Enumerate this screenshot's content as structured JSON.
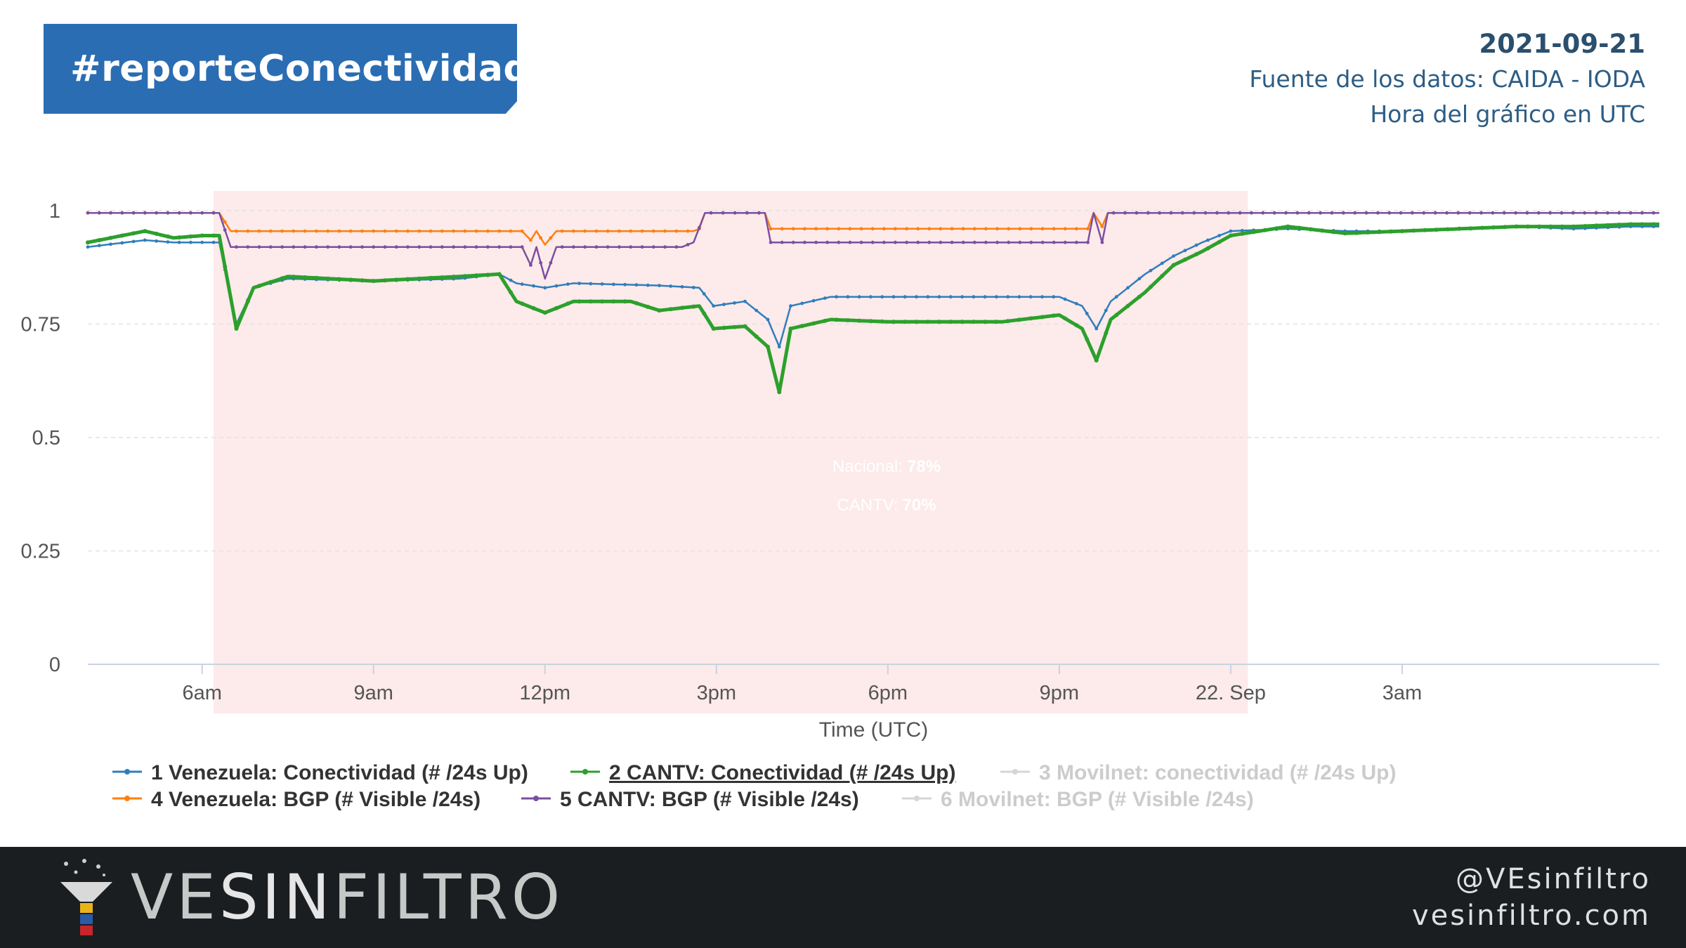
{
  "header": {
    "hashtag": "#reporteConectividad",
    "date": "2021-09-21",
    "source": "Fuente de los datos: CAIDA - IODA",
    "time_note": "Hora del gráfico en UTC"
  },
  "badges": {
    "national_label": "Nacional:",
    "national_value": "78%",
    "cantv_label": "CANTV:",
    "cantv_value": "70%"
  },
  "footer": {
    "brand_a": "VE",
    "brand_b": "SIN",
    "brand_c": "FILTRO",
    "handle": "@VEsinfiltro",
    "site": "vesinfiltro.com"
  },
  "colors": {
    "nacional": "#2f7ebc",
    "cantv": "#2ca02c",
    "bgp_ve": "#ff7f0e",
    "bgp_cantv": "#7b4fa0",
    "disabled": "#d6d6d6",
    "shade": "#fdeaea",
    "badge_blue": "#2a6db3",
    "badge_green": "#2ca02c"
  },
  "chart_data": {
    "type": "line",
    "xlabel": "Time (UTC)",
    "ylabel": "",
    "ylim": [
      0,
      1
    ],
    "xlim_hours": [
      4,
      31.5
    ],
    "x_unit": "hours since 2021-09-21 00:00 UTC",
    "yticks": [
      {
        "value": 0,
        "label": "0"
      },
      {
        "value": 0.25,
        "label": "0.25"
      },
      {
        "value": 0.5,
        "label": "0.5"
      },
      {
        "value": 0.75,
        "label": "0.75"
      },
      {
        "value": 1,
        "label": "1"
      }
    ],
    "xticks": [
      {
        "value": 6,
        "label": "6am"
      },
      {
        "value": 9,
        "label": "9am"
      },
      {
        "value": 12,
        "label": "12pm"
      },
      {
        "value": 15,
        "label": "3pm"
      },
      {
        "value": 18,
        "label": "6pm"
      },
      {
        "value": 21,
        "label": "9pm"
      },
      {
        "value": 24,
        "label": "22. Sep"
      },
      {
        "value": 27,
        "label": "3am"
      }
    ],
    "highlight_band": [
      6.2,
      24.3
    ],
    "grid": "horizontal dashed",
    "legend_position": "bottom",
    "series": [
      {
        "name": "1 Venezuela: Conectividad (# /24s Up)",
        "color": "#2f7ebc",
        "enabled": true,
        "points": [
          [
            4.0,
            0.92
          ],
          [
            5.0,
            0.935
          ],
          [
            5.5,
            0.93
          ],
          [
            6.0,
            0.93
          ],
          [
            6.3,
            0.93
          ],
          [
            6.6,
            0.75
          ],
          [
            6.9,
            0.83
          ],
          [
            7.5,
            0.85
          ],
          [
            9.0,
            0.845
          ],
          [
            10.5,
            0.85
          ],
          [
            11.2,
            0.86
          ],
          [
            11.5,
            0.84
          ],
          [
            12.0,
            0.83
          ],
          [
            12.5,
            0.84
          ],
          [
            14.0,
            0.835
          ],
          [
            14.7,
            0.83
          ],
          [
            14.95,
            0.79
          ],
          [
            15.5,
            0.8
          ],
          [
            15.9,
            0.76
          ],
          [
            16.1,
            0.7
          ],
          [
            16.3,
            0.79
          ],
          [
            17.0,
            0.81
          ],
          [
            18.0,
            0.81
          ],
          [
            20.0,
            0.81
          ],
          [
            21.0,
            0.81
          ],
          [
            21.4,
            0.79
          ],
          [
            21.65,
            0.74
          ],
          [
            21.9,
            0.8
          ],
          [
            22.5,
            0.86
          ],
          [
            23.0,
            0.9
          ],
          [
            23.5,
            0.93
          ],
          [
            24.0,
            0.955
          ],
          [
            25.0,
            0.96
          ],
          [
            26.0,
            0.955
          ],
          [
            27.0,
            0.955
          ],
          [
            28.0,
            0.96
          ],
          [
            29.0,
            0.965
          ],
          [
            30.0,
            0.96
          ],
          [
            31.0,
            0.965
          ],
          [
            31.5,
            0.965
          ]
        ]
      },
      {
        "name": "2 CANTV: Conectividad (# /24s Up)",
        "color": "#2ca02c",
        "enabled": true,
        "points": [
          [
            4.0,
            0.93
          ],
          [
            5.0,
            0.955
          ],
          [
            5.5,
            0.94
          ],
          [
            6.0,
            0.945
          ],
          [
            6.3,
            0.945
          ],
          [
            6.6,
            0.74
          ],
          [
            6.9,
            0.83
          ],
          [
            7.5,
            0.855
          ],
          [
            9.0,
            0.845
          ],
          [
            10.5,
            0.855
          ],
          [
            11.2,
            0.86
          ],
          [
            11.5,
            0.8
          ],
          [
            12.0,
            0.775
          ],
          [
            12.5,
            0.8
          ],
          [
            13.5,
            0.8
          ],
          [
            14.0,
            0.78
          ],
          [
            14.7,
            0.79
          ],
          [
            14.95,
            0.74
          ],
          [
            15.5,
            0.745
          ],
          [
            15.9,
            0.7
          ],
          [
            16.1,
            0.6
          ],
          [
            16.3,
            0.74
          ],
          [
            17.0,
            0.76
          ],
          [
            18.0,
            0.755
          ],
          [
            20.0,
            0.755
          ],
          [
            21.0,
            0.77
          ],
          [
            21.4,
            0.74
          ],
          [
            21.65,
            0.67
          ],
          [
            21.9,
            0.76
          ],
          [
            22.5,
            0.82
          ],
          [
            23.0,
            0.88
          ],
          [
            23.5,
            0.91
          ],
          [
            24.0,
            0.945
          ],
          [
            25.0,
            0.965
          ],
          [
            26.0,
            0.95
          ],
          [
            27.0,
            0.955
          ],
          [
            28.0,
            0.96
          ],
          [
            29.0,
            0.965
          ],
          [
            30.0,
            0.965
          ],
          [
            31.0,
            0.97
          ],
          [
            31.5,
            0.97
          ]
        ]
      },
      {
        "name": "3 Movilnet: conectividad (# /24s Up)",
        "color": "#d6d6d6",
        "enabled": false,
        "points": []
      },
      {
        "name": "4 Venezuela: BGP (# Visible /24s)",
        "color": "#ff7f0e",
        "enabled": true,
        "points": [
          [
            4.0,
            0.995
          ],
          [
            6.3,
            0.995
          ],
          [
            6.5,
            0.955
          ],
          [
            11.6,
            0.955
          ],
          [
            11.75,
            0.935
          ],
          [
            11.85,
            0.955
          ],
          [
            12.0,
            0.925
          ],
          [
            12.2,
            0.955
          ],
          [
            14.6,
            0.955
          ],
          [
            14.7,
            0.96
          ],
          [
            14.8,
            0.995
          ],
          [
            15.85,
            0.995
          ],
          [
            15.95,
            0.96
          ],
          [
            21.5,
            0.96
          ],
          [
            21.6,
            0.995
          ],
          [
            21.75,
            0.965
          ],
          [
            21.85,
            0.995
          ],
          [
            31.5,
            0.995
          ]
        ]
      },
      {
        "name": "5 CANTV: BGP (# Visible /24s)",
        "color": "#7b4fa0",
        "enabled": true,
        "points": [
          [
            4.0,
            0.995
          ],
          [
            6.3,
            0.995
          ],
          [
            6.5,
            0.92
          ],
          [
            11.6,
            0.92
          ],
          [
            11.75,
            0.88
          ],
          [
            11.85,
            0.92
          ],
          [
            12.0,
            0.85
          ],
          [
            12.2,
            0.92
          ],
          [
            14.4,
            0.92
          ],
          [
            14.6,
            0.93
          ],
          [
            14.8,
            0.995
          ],
          [
            15.85,
            0.995
          ],
          [
            15.95,
            0.93
          ],
          [
            21.5,
            0.93
          ],
          [
            21.6,
            0.995
          ],
          [
            21.75,
            0.93
          ],
          [
            21.85,
            0.995
          ],
          [
            31.5,
            0.995
          ]
        ]
      },
      {
        "name": "6 Movilnet: BGP (# Visible /24s)",
        "color": "#d6d6d6",
        "enabled": false,
        "points": []
      }
    ]
  }
}
